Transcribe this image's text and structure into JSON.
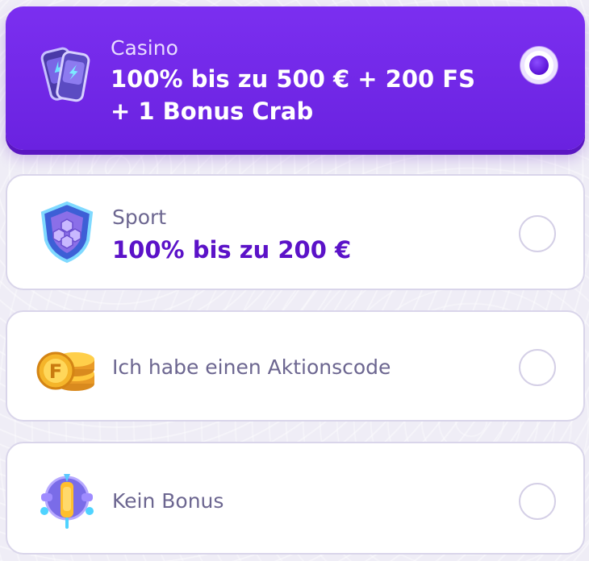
{
  "options": [
    {
      "icon": "casino-cards-icon",
      "label": "Casino",
      "detail_line1": "100% bis zu 500 € + 200 FS",
      "detail_line2": "+ 1 Bonus Crab",
      "selected": true
    },
    {
      "icon": "sport-shield-icon",
      "label": "Sport",
      "detail_line1": "100% bis zu 200 €",
      "selected": false
    },
    {
      "icon": "promo-coins-icon",
      "label": "Ich habe einen Aktionscode",
      "selected": false
    },
    {
      "icon": "no-bonus-ufo-icon",
      "label": "Kein Bonus",
      "selected": false
    }
  ],
  "colors": {
    "selected_bg": "#7b2ff0",
    "detail_text": "#5b12c8",
    "label_text": "#6c6690",
    "border": "#d9d5ea"
  }
}
